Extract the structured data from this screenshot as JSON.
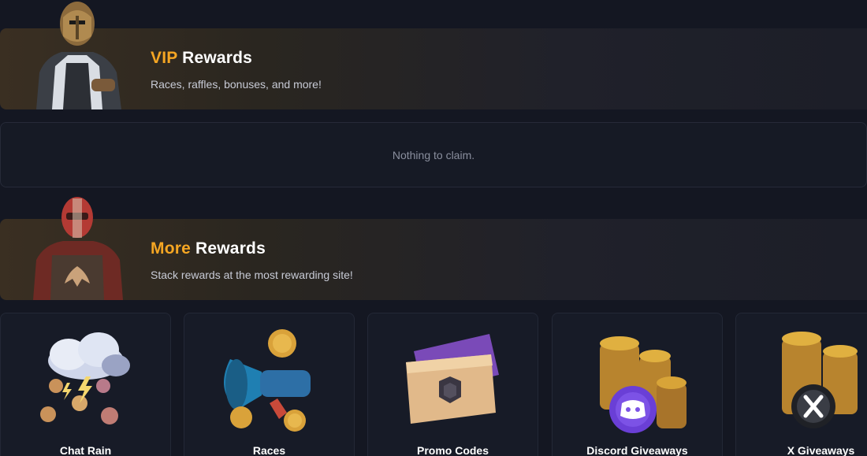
{
  "vip": {
    "title_accent": "VIP",
    "title_rest": "Rewards",
    "subtitle": "Races, raffles, bonuses, and more!"
  },
  "claim": {
    "message": "Nothing to claim."
  },
  "more": {
    "title_accent": "More",
    "title_rest": "Rewards",
    "subtitle": "Stack rewards at the most rewarding site!"
  },
  "cards": [
    {
      "label": "Chat Rain",
      "icon": "cloud-rain-coins-icon"
    },
    {
      "label": "Races",
      "icon": "megaphone-coins-icon"
    },
    {
      "label": "Promo Codes",
      "icon": "ticket-icon"
    },
    {
      "label": "Discord Giveaways",
      "icon": "discord-coins-icon"
    },
    {
      "label": "X Giveaways",
      "icon": "x-coins-icon"
    }
  ],
  "colors": {
    "accent": "#f5a623",
    "background": "#141722",
    "card": "#171b27"
  }
}
